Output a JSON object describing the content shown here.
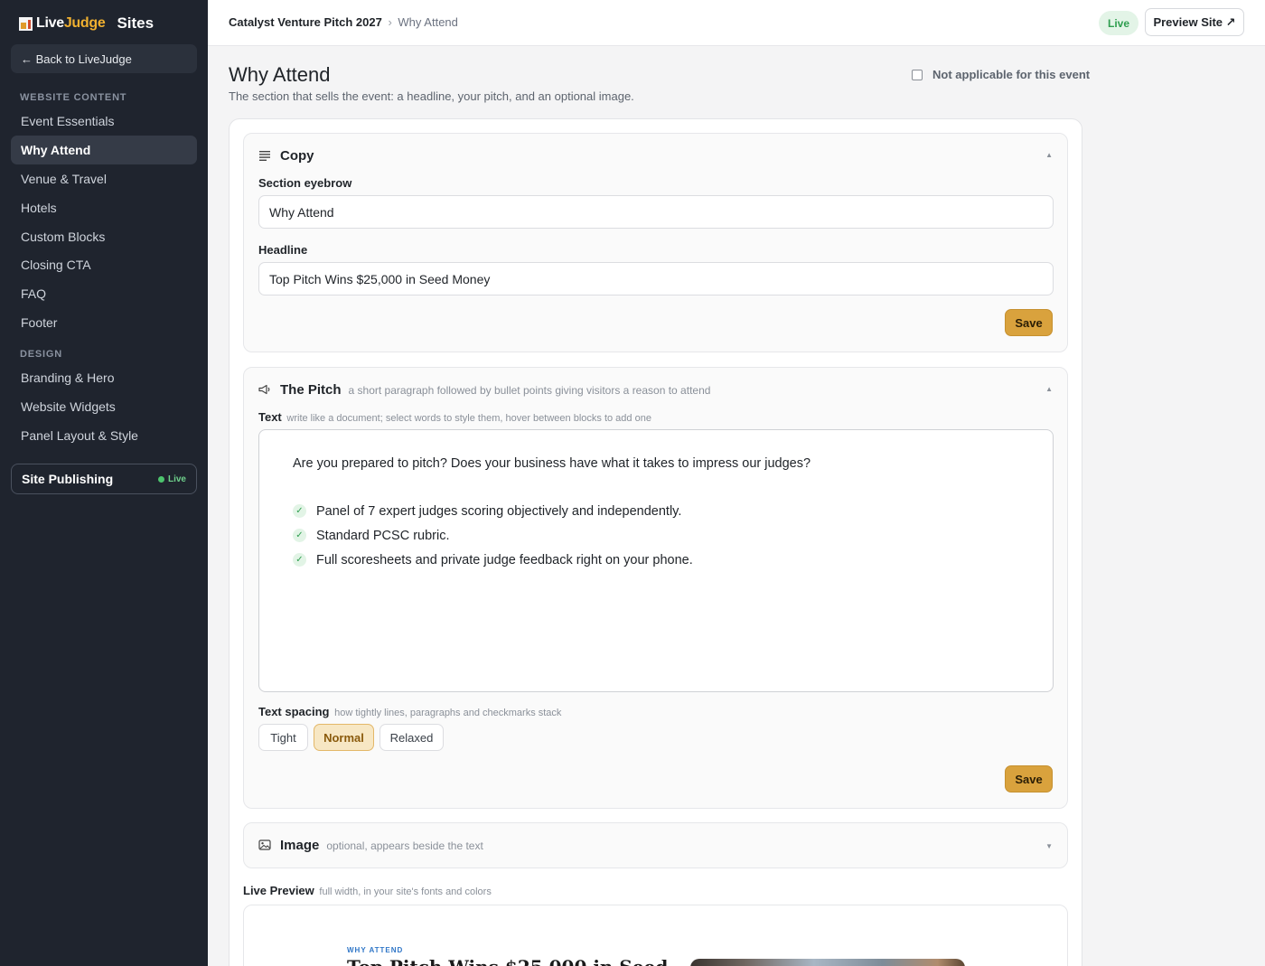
{
  "brand": {
    "logo_live": "Live",
    "logo_judge": "Judge",
    "product": "Sites"
  },
  "sidebar": {
    "back_label": "← Back to LiveJudge",
    "sections": [
      {
        "title": "WEBSITE CONTENT",
        "items": [
          "Event Essentials",
          "Why Attend",
          "Venue & Travel",
          "Hotels",
          "Custom Blocks",
          "Closing CTA",
          "FAQ",
          "Footer"
        ]
      },
      {
        "title": "DESIGN",
        "items": [
          "Branding & Hero",
          "Website Widgets",
          "Panel Layout & Style"
        ]
      }
    ],
    "active_item": "Why Attend",
    "publishing": {
      "label": "Site Publishing",
      "status": "Live"
    }
  },
  "topbar": {
    "breadcrumb_event": "Catalyst Venture Pitch 2027",
    "breadcrumb_sep": "›",
    "breadcrumb_page": "Why Attend",
    "status": "Live",
    "preview_label": "Preview Site ↗"
  },
  "page": {
    "title": "Why Attend",
    "subtitle": "The section that sells the event: a headline, your pitch, and an optional image.",
    "not_applicable_label": "Not applicable for this event",
    "not_applicable_checked": false
  },
  "copy_panel": {
    "title": "Copy",
    "eyebrow_label": "Section eyebrow",
    "eyebrow_value": "Why Attend",
    "headline_label": "Headline",
    "headline_value": "Top Pitch Wins $25,000 in Seed Money",
    "save_label": "Save",
    "collapse_icon": "▲"
  },
  "pitch_panel": {
    "title": "The Pitch",
    "hint": "a short paragraph followed by bullet points giving visitors a reason to attend",
    "text_label": "Text",
    "text_hint": "write like a document; select words to style them, hover between blocks to add one",
    "paragraph": "Are you prepared to pitch? Does your business have what it takes to impress our judges?",
    "bullets": [
      "Panel of 7 expert judges scoring objectively and independently.",
      "Standard PCSC rubric.",
      "Full scoresheets and private judge feedback right on your phone."
    ],
    "spacing_label": "Text spacing",
    "spacing_hint": "how tightly lines, paragraphs and checkmarks stack",
    "spacing_options": [
      "Tight",
      "Normal",
      "Relaxed"
    ],
    "spacing_selected": "Normal",
    "save_label": "Save",
    "collapse_icon": "▲"
  },
  "image_panel": {
    "title": "Image",
    "hint": "optional, appears beside the text",
    "expand_icon": "▼"
  },
  "live_preview": {
    "label": "Live Preview",
    "hint": "full width, in your site's fonts and colors",
    "eyebrow": "WHY ATTEND",
    "headline": "Top Pitch Wins $25,000 in Seed"
  },
  "colors": {
    "sidebar_bg": "#1f242e",
    "accent": "#d9a23d",
    "live_green": "#2f9e4f",
    "preview_eyebrow": "#2f76c7"
  }
}
